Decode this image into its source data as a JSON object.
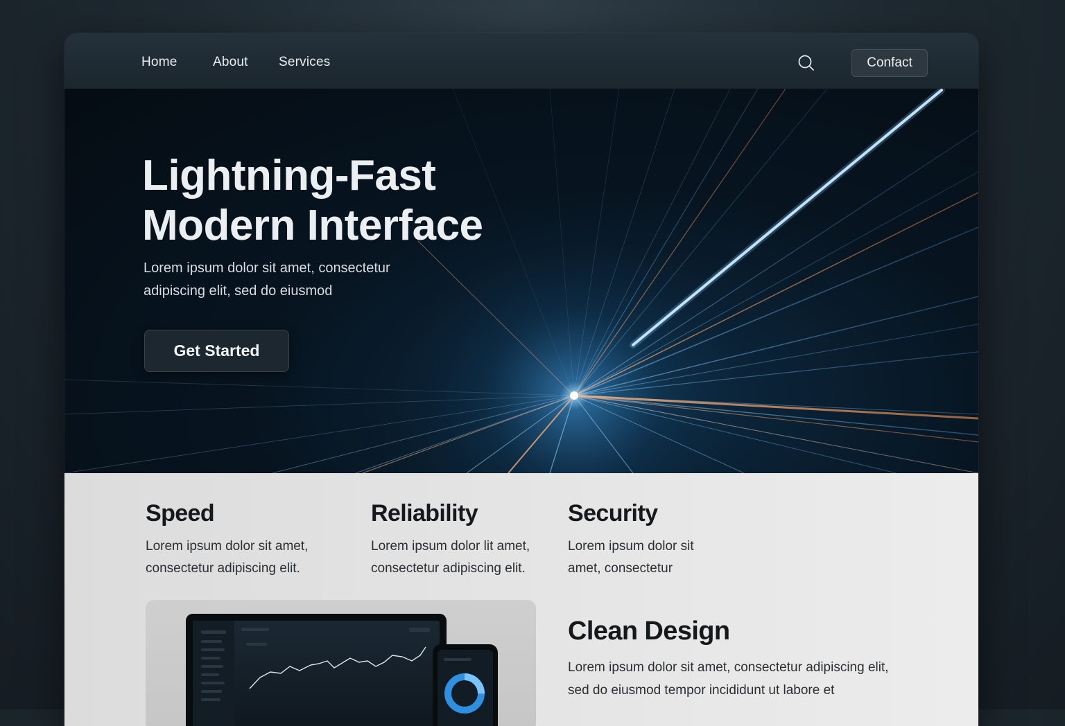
{
  "nav": {
    "links": [
      "Home",
      "About",
      "Services"
    ],
    "search_icon": "search-icon",
    "contact_label": "Confact"
  },
  "hero": {
    "title_lines": [
      "Lightning-Fast",
      "Modern Interface"
    ],
    "subtitle_lines": [
      "Lorem ipsum dolor sit amet, consectetur",
      "adipiscing elit, sed do eiusmod"
    ],
    "cta_label": "Get Started",
    "colors": {
      "blue_ray": "#4fb3ff",
      "orange_ray": "#ff8a3d",
      "background": "#050c13"
    }
  },
  "features": [
    {
      "title": "Speed",
      "lines": [
        "Lorem ipsum dolor sit amet,",
        "consectetur adipiscing elit."
      ]
    },
    {
      "title": "Reliability",
      "lines": [
        "Lorem ipsum dolor lit amet,",
        "consectetur adipiscing elit."
      ]
    },
    {
      "title": "Security",
      "lines": [
        "Lorem ipsum dolor sit",
        "amet, consectetur"
      ]
    }
  ],
  "clean_design": {
    "title": "Clean Design",
    "lines": [
      "Lorem ipsum dolor sit amet,  consectetur adipiscing elit,",
      "sed do eiusmod tempor incididunt ut labore et"
    ]
  }
}
